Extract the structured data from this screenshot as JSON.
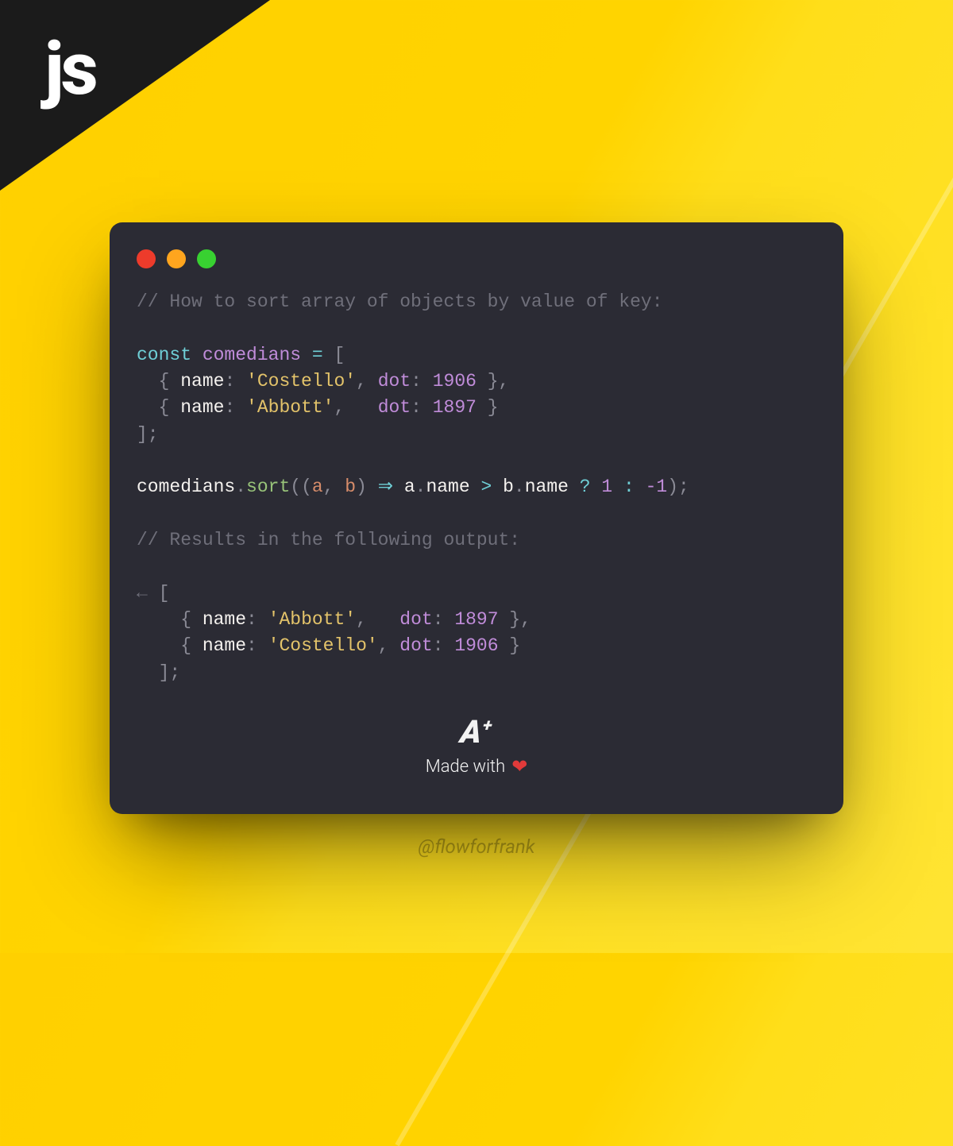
{
  "badge": {
    "label": "js"
  },
  "code": {
    "comment_top": "// How to sort array of objects by value of key:",
    "decl_keyword": "const",
    "array_name": "comedians",
    "assign": "=",
    "open_bracket": "[",
    "obj_open": "{ ",
    "obj_close": " }",
    "name_key": "name",
    "dot_key": "dot",
    "row1_name": "'Costello'",
    "row1_dot": "1906",
    "row2_name": "'Abbott'",
    "row2_dot": "1897",
    "close_bracket_semi": "];",
    "sort_fn": "sort",
    "param_a": "a",
    "param_b": "b",
    "arrow": "⇒",
    "gt": ">",
    "qmark": "?",
    "ternary_true": "1",
    "colon": ":",
    "ternary_false": "-1",
    "comment_mid": "// Results in the following output:",
    "result_marker": "←",
    "res_row1_name": "'Abbott'",
    "res_row1_dot": "1897",
    "res_row2_name": "'Costello'",
    "res_row2_dot": "1906"
  },
  "footer": {
    "brand": "A",
    "brand_plus": "+",
    "made_with": "Made with",
    "heart": "❤"
  },
  "handle": "@flowforfrank"
}
